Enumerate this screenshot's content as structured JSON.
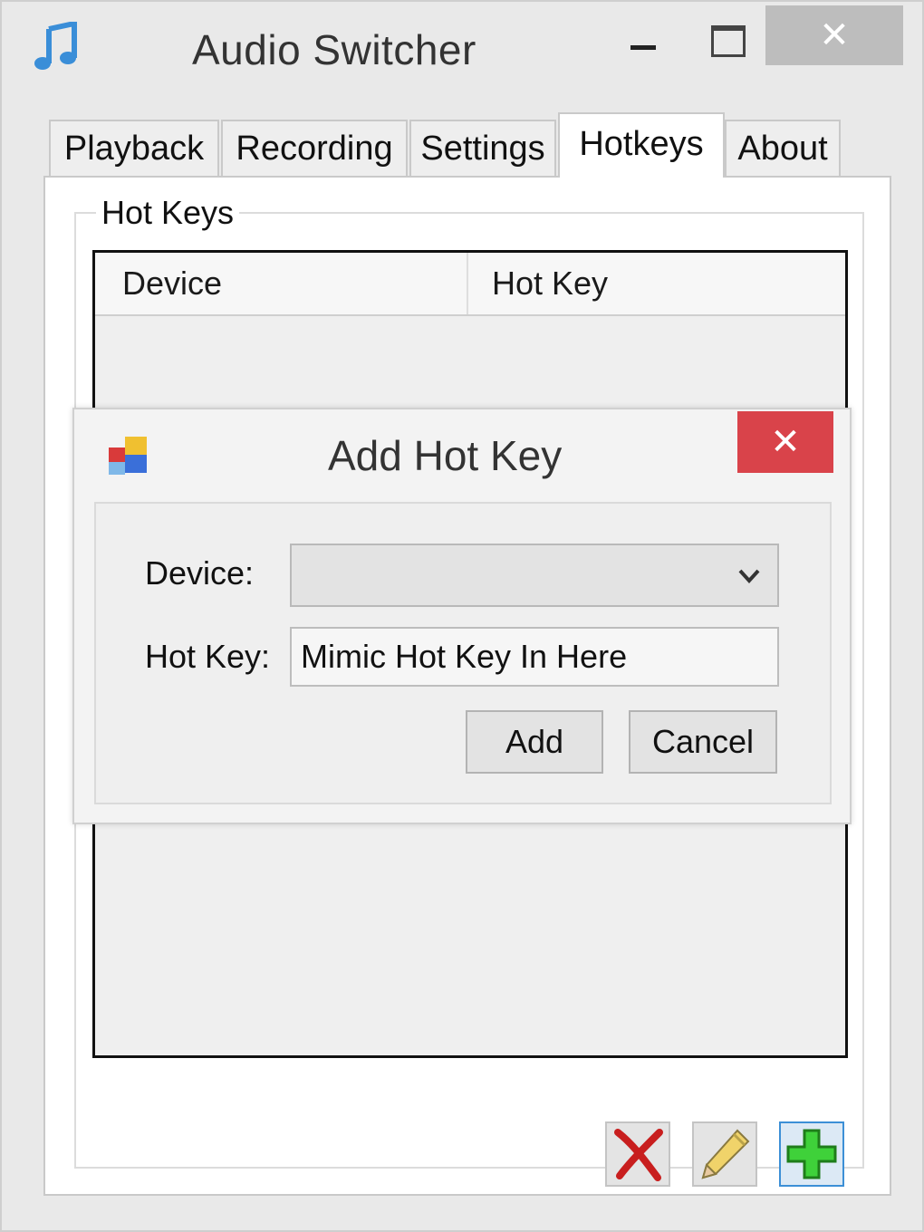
{
  "window": {
    "title": "Audio Switcher",
    "minimize_glyph": "",
    "maximize_glyph": "",
    "close_glyph": "✕"
  },
  "tabs": [
    {
      "label": "Playback"
    },
    {
      "label": "Recording"
    },
    {
      "label": "Settings"
    },
    {
      "label": "Hotkeys",
      "active": true
    },
    {
      "label": "About"
    }
  ],
  "hotkeys_group": {
    "label": "Hot Keys",
    "columns": [
      "Device",
      "Hot Key"
    ],
    "rows": []
  },
  "toolbar": {
    "delete_icon": "red-x-icon",
    "edit_icon": "pencil-icon",
    "add_icon": "green-plus-icon"
  },
  "dialog": {
    "title": "Add Hot Key",
    "close_glyph": "✕",
    "device_label": "Device:",
    "device_value": "",
    "hotkey_label": "Hot Key:",
    "hotkey_value": "Mimic Hot Key In Here",
    "add_label": "Add",
    "cancel_label": "Cancel"
  },
  "colors": {
    "accent_close": "#d9434a",
    "selected_button_border": "#3c8fd6"
  }
}
